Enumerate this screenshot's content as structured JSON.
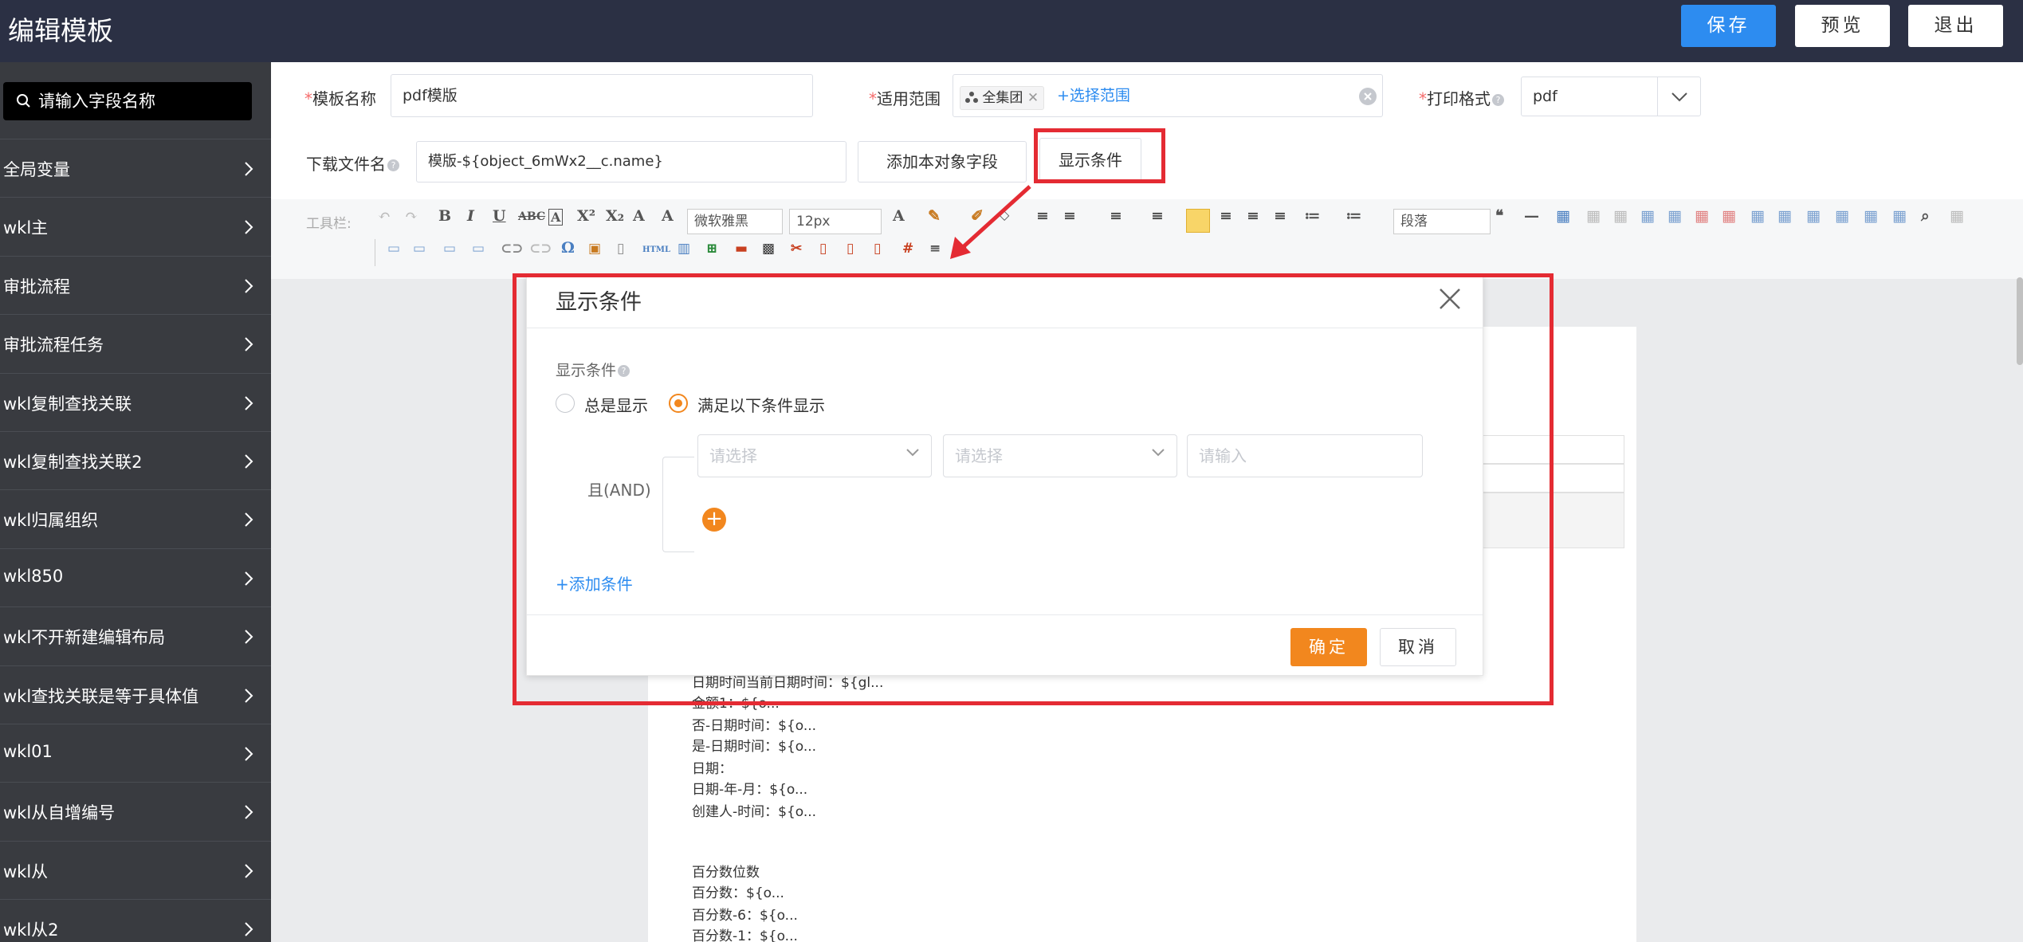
{
  "header": {
    "title": "编辑模板",
    "save_label": "保存",
    "preview_label": "预览",
    "exit_label": "退出"
  },
  "sidebar": {
    "search_placeholder": "请输入字段名称",
    "items": [
      {
        "label": "全局变量"
      },
      {
        "label": "wkl主"
      },
      {
        "label": "审批流程"
      },
      {
        "label": "审批流程任务"
      },
      {
        "label": "wkl复制查找关联"
      },
      {
        "label": "wkl复制查找关联2"
      },
      {
        "label": "wkl归属组织"
      },
      {
        "label": "wkl850"
      },
      {
        "label": "wkl不开新建编辑布局"
      },
      {
        "label": "wkl查找关联是等于具体值"
      },
      {
        "label": "wkl01"
      },
      {
        "label": "wkl从自增编号"
      },
      {
        "label": "wkl从"
      },
      {
        "label": "wkl从2"
      }
    ]
  },
  "form": {
    "template_name_label": "模板名称",
    "template_name_value": "pdf模版",
    "scope_label": "适用范围",
    "scope_tag": "全集团",
    "scope_select_link": "+选择范围",
    "print_format_label": "打印格式",
    "print_format_value": "pdf",
    "download_name_label": "下载文件名",
    "download_name_value": "模版-${object_6mWx2__c.name}",
    "add_field_button": "添加本对象字段",
    "display_condition_button": "显示条件"
  },
  "toolbar": {
    "label": "工具栏:",
    "font_family": "微软雅黑",
    "font_size": "12px",
    "paragraph": "段落"
  },
  "paper": {
    "lines": [
      "日期时间当前日期时间：${gl...",
      "金额1：${o...",
      "否-日期时间：${o...",
      "是-日期时间：${o...",
      "日期：",
      "日期-年-月：${o...",
      "创建人-时间：${o...",
      "百分数位数",
      "百分数：${o...",
      "百分数-6：${o...",
      "百分数-1：${o..."
    ]
  },
  "dialog": {
    "title": "显示条件",
    "condition_label": "显示条件",
    "radio_always": "总是显示",
    "radio_conditional": "满足以下条件显示",
    "selected": "conditional",
    "and_label": "且(AND)",
    "select1_placeholder": "请选择",
    "select2_placeholder": "请选择",
    "input_placeholder": "请输入",
    "add_condition": "+添加条件",
    "ok_label": "确定",
    "cancel_label": "取消"
  },
  "colors": {
    "header_bg": "#2b3044",
    "sidebar_bg": "#393b40",
    "primary_blue": "#2d8cf0",
    "accent_orange": "#f2871e",
    "annotation_red": "#e42b33"
  }
}
